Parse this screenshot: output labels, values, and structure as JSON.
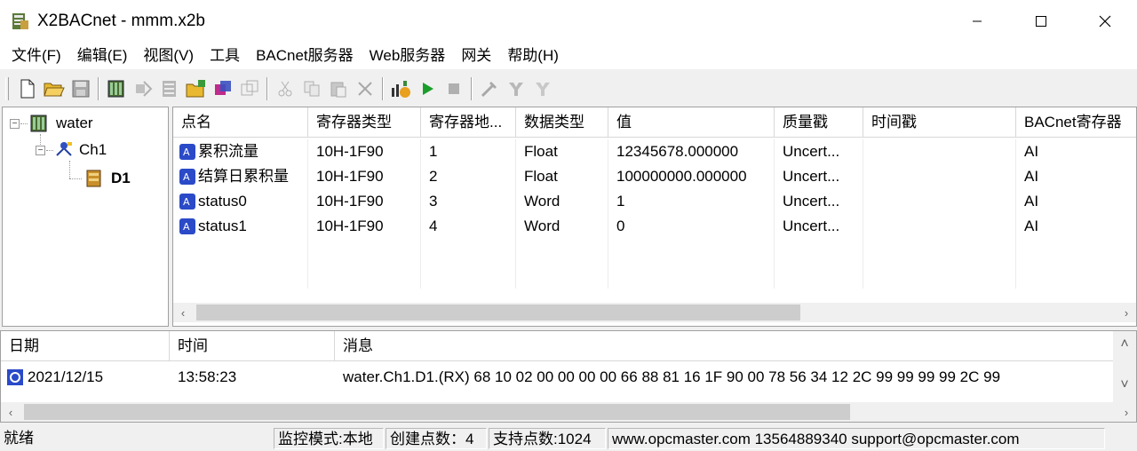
{
  "window": {
    "title": "X2BACnet - mmm.x2b",
    "minimize_glyph": "—",
    "maximize_glyph": "☐",
    "close_glyph": "✕"
  },
  "menu": [
    "文件(F)",
    "编辑(E)",
    "视图(V)",
    "工具",
    "BACnet服务器",
    "Web服务器",
    "网关",
    "帮助(H)"
  ],
  "toolbar": {
    "icons": [
      "new-file-icon",
      "open-folder-icon",
      "save-icon",
      "add-channel-icon",
      "add-device-icon",
      "add-point-icon",
      "import-icon",
      "bacnet-icon",
      "export-icon",
      "cut-icon",
      "copy-icon",
      "paste-icon",
      "delete-icon",
      "monitor-icon",
      "run-icon",
      "stop-icon",
      "tools-icon",
      "settings-icon",
      "settings-2-icon"
    ],
    "colors": {
      "run": "#1a9e2a",
      "stop": "#b0b0b0"
    }
  },
  "tree": {
    "root": {
      "label": "water",
      "expander": "⊟"
    },
    "channel": {
      "label": "Ch1",
      "expander": "⊟"
    },
    "device": {
      "label": "D1"
    }
  },
  "grid": {
    "columns": [
      "点名",
      "寄存器类型",
      "寄存器地...",
      "数据类型",
      "值",
      "质量戳",
      "时间戳",
      "BACnet寄存器"
    ],
    "rows": [
      {
        "name": "累积流量",
        "reg_type": "10H-1F90",
        "address": "1",
        "data_type": "Float",
        "value": "12345678.000000",
        "quality": "Uncert...",
        "timestamp": "",
        "bacnet": "AI"
      },
      {
        "name": "结算日累积量",
        "reg_type": "10H-1F90",
        "address": "2",
        "data_type": "Float",
        "value": "100000000.000000",
        "quality": "Uncert...",
        "timestamp": "",
        "bacnet": "AI"
      },
      {
        "name": "status0",
        "reg_type": "10H-1F90",
        "address": "3",
        "data_type": "Word",
        "value": "1",
        "quality": "Uncert...",
        "timestamp": "",
        "bacnet": "AI"
      },
      {
        "name": "status1",
        "reg_type": "10H-1F90",
        "address": "4",
        "data_type": "Word",
        "value": "0",
        "quality": "Uncert...",
        "timestamp": "",
        "bacnet": "AI"
      }
    ]
  },
  "log": {
    "columns": [
      "日期",
      "时间",
      "消息"
    ],
    "rows": [
      {
        "date": "2021/12/15",
        "time": "13:58:23",
        "message": "water.Ch1.D1.(RX) 68 10 02 00 00 00 00 66 88 81 16 1F 90 00 78 56 34 12 2C 99 99 99 99 2C 99"
      }
    ]
  },
  "scroll": {
    "left": "‹",
    "right": "›",
    "up": "˄",
    "down": "˅"
  },
  "status": {
    "ready": "就绪",
    "mode": "监控模式:本地",
    "created": "创建点数：4",
    "supported": "支持点数:1024",
    "contact": "www.opcmaster.com 13564889340 support@opcmaster.com"
  }
}
